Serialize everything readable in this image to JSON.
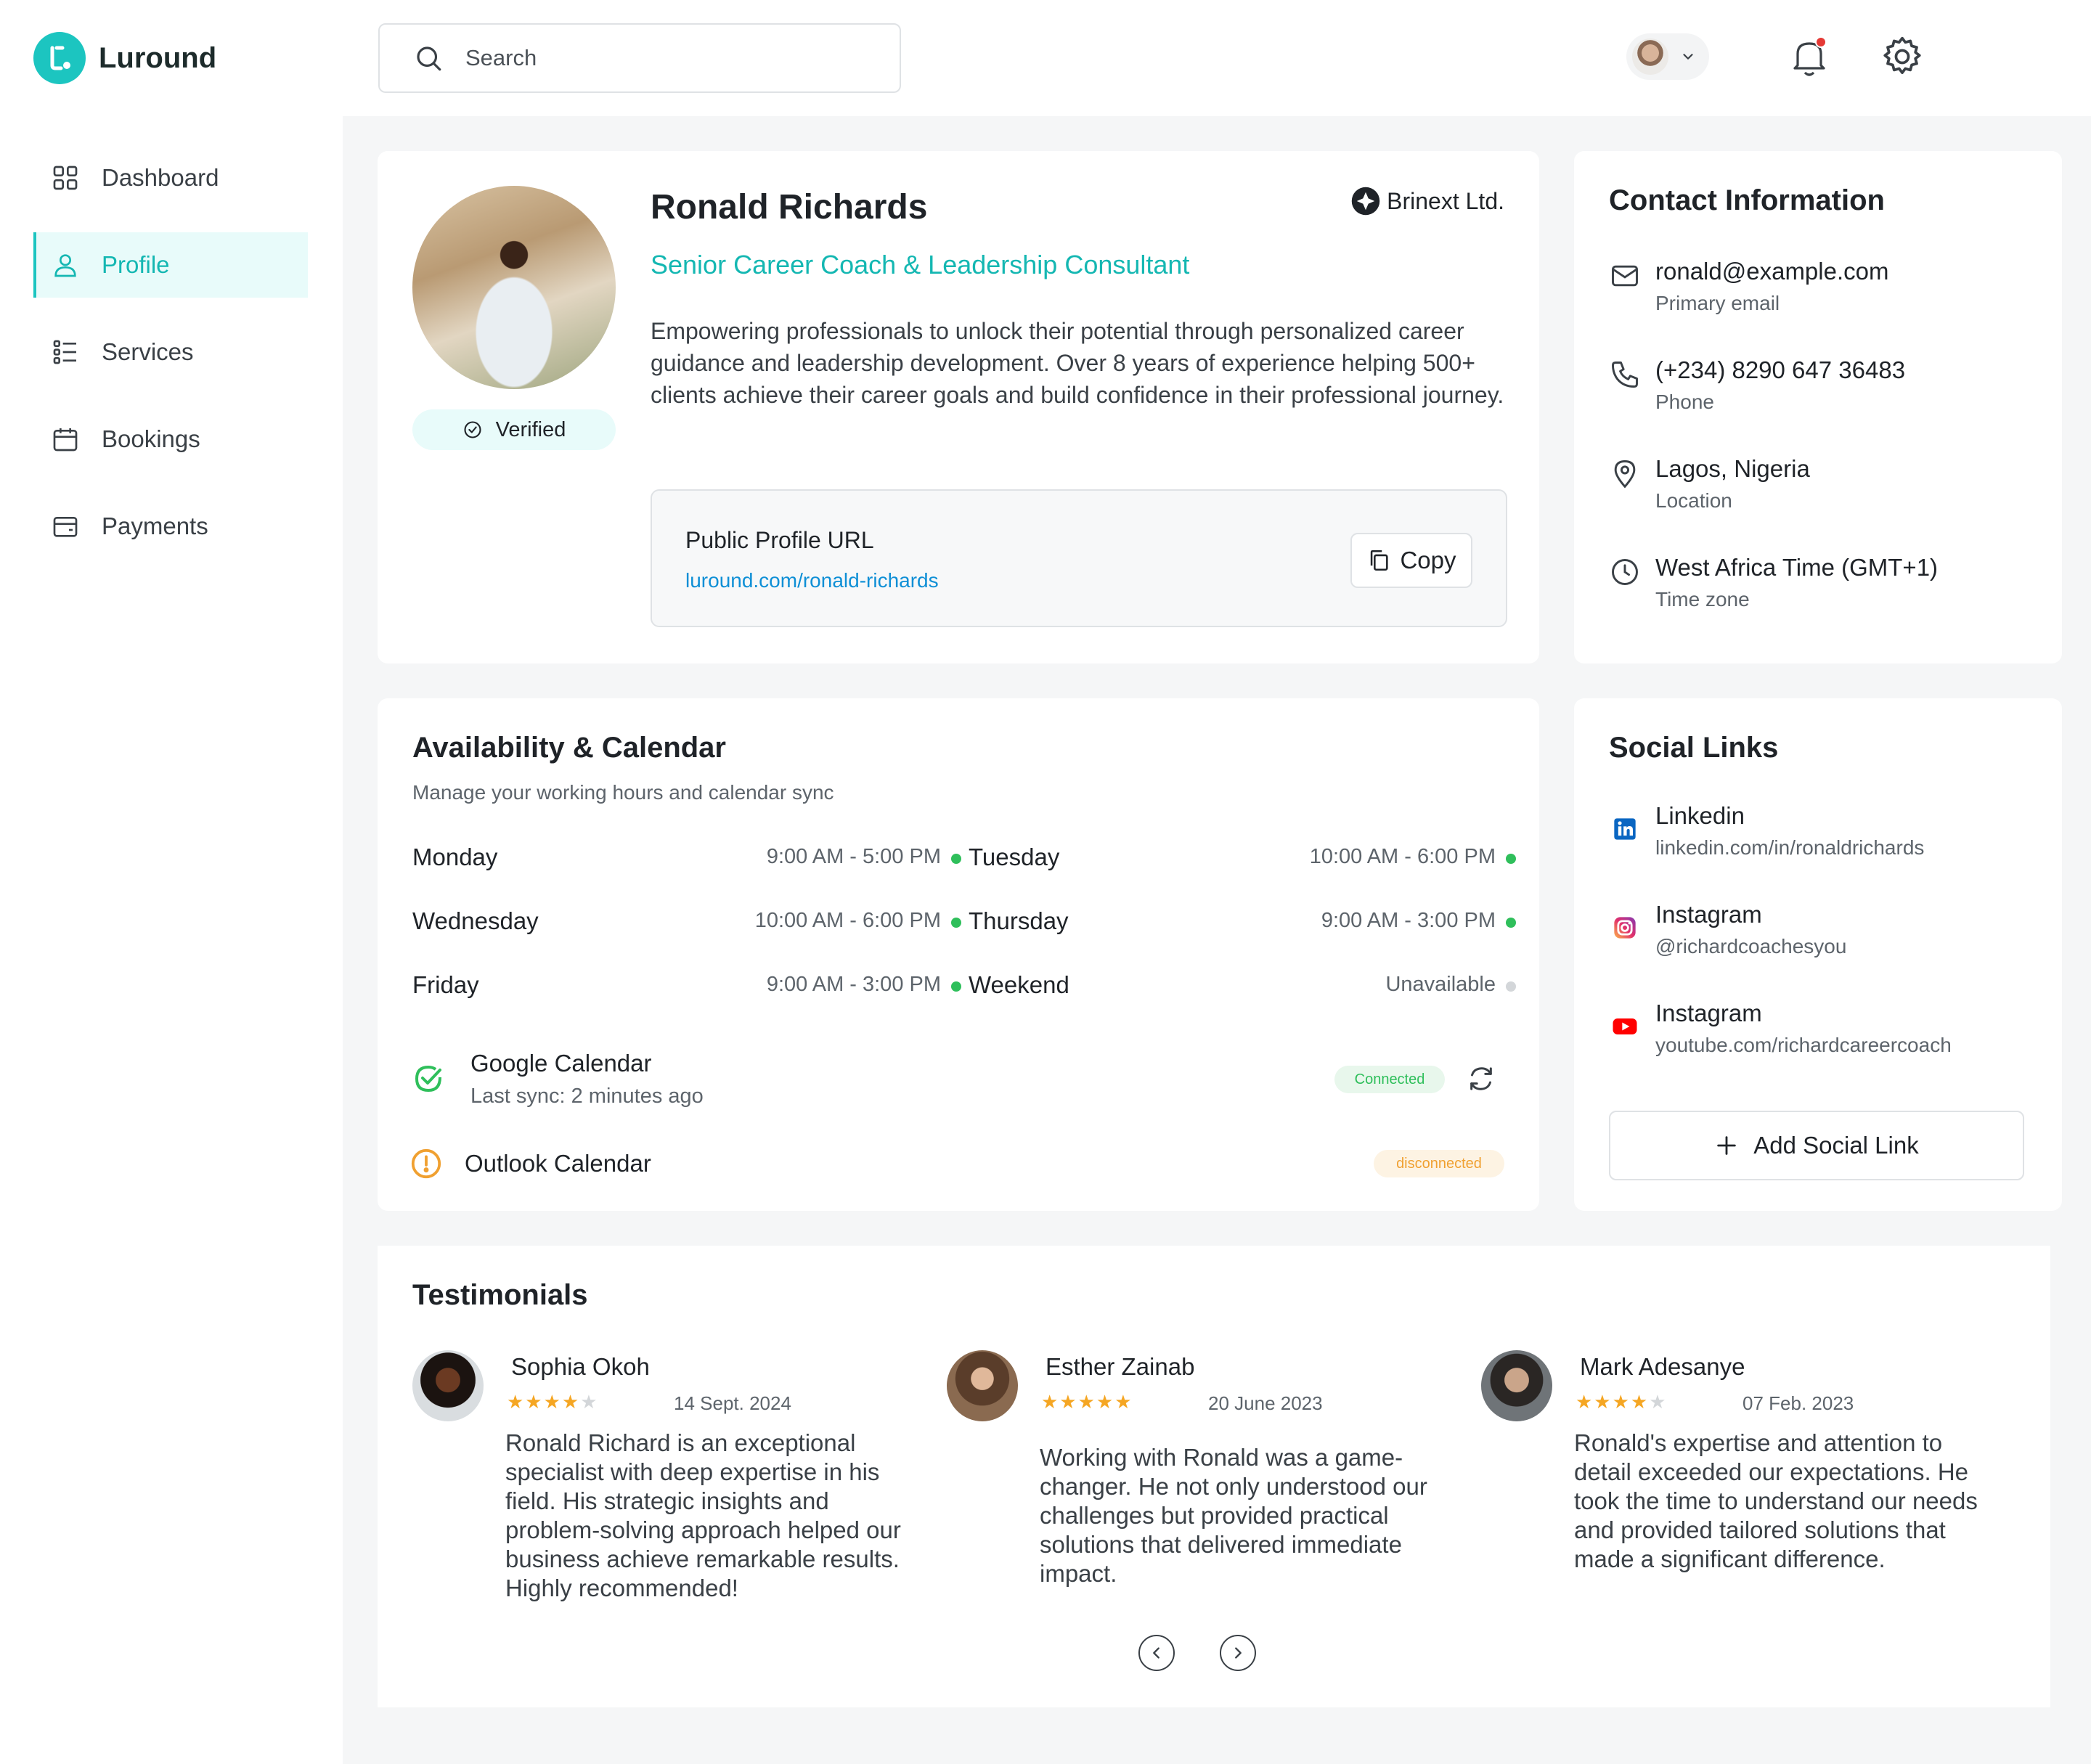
{
  "brand": {
    "name": "Luround",
    "accent": "#1cc5c0"
  },
  "sidebar": {
    "items": [
      {
        "label": "Dashboard",
        "icon": "grid-icon",
        "active": false
      },
      {
        "label": "Profile",
        "icon": "user-icon",
        "active": true
      },
      {
        "label": "Services",
        "icon": "list-icon",
        "active": false
      },
      {
        "label": "Bookings",
        "icon": "calendar-icon",
        "active": false
      },
      {
        "label": "Payments",
        "icon": "wallet-icon",
        "active": false
      }
    ]
  },
  "search": {
    "placeholder": "Search"
  },
  "profile": {
    "name": "Ronald Richards",
    "company": "Brinext Ltd.",
    "title": "Senior Career Coach & Leadership Consultant",
    "bio": "Empowering professionals to unlock their potential through personalized career guidance and leadership development. Over 8 years of experience helping 500+ clients achieve their career goals and build confidence in their professional journey.",
    "verified_label": "Verified",
    "url_label": "Public Profile URL",
    "url": "luround.com/ronald-richards",
    "copy_label": "Copy"
  },
  "contact": {
    "title": "Contact Information",
    "rows": [
      {
        "icon": "mail-icon",
        "value": "ronald@example.com",
        "label": "Primary email"
      },
      {
        "icon": "phone-icon",
        "value": "(+234) 8290 647 36483",
        "label": "Phone"
      },
      {
        "icon": "location-pin-icon",
        "value": "Lagos, Nigeria",
        "label": "Location"
      },
      {
        "icon": "clock-icon",
        "value": "West Africa Time (GMT+1)",
        "label": "Time zone"
      }
    ]
  },
  "availability": {
    "title": "Availability & Calendar",
    "subtitle": "Manage your working hours and calendar sync",
    "days": [
      {
        "day": "Monday",
        "hours": "9:00 AM - 5:00 PM",
        "available": true
      },
      {
        "day": "Tuesday",
        "hours": "10:00 AM - 6:00 PM",
        "available": true
      },
      {
        "day": "Wednesday",
        "hours": "10:00 AM - 6:00 PM",
        "available": true
      },
      {
        "day": "Thursday",
        "hours": "9:00 AM - 3:00 PM",
        "available": true
      },
      {
        "day": "Friday",
        "hours": "9:00 AM - 3:00 PM",
        "available": true
      },
      {
        "day": "Weekend",
        "hours": "Unavailable",
        "available": false
      }
    ],
    "calendars": [
      {
        "name": "Google Calendar",
        "sub": "Last sync: 2 minutes ago",
        "status": "Connected"
      },
      {
        "name": "Outlook Calendar",
        "sub": "",
        "status": "disconnected"
      }
    ],
    "colors": {
      "available": "#2fbf5b",
      "unavailable": "#d3d6d9",
      "warning": "#f0a030"
    }
  },
  "social": {
    "title": "Social Links",
    "links": [
      {
        "icon": "linkedin-icon",
        "name": "Linkedin",
        "handle": "linkedin.com/in/ronaldrichards"
      },
      {
        "icon": "instagram-icon",
        "name": "Instagram",
        "handle": "@richardcoachesyou"
      },
      {
        "icon": "youtube-icon",
        "name": "Instagram",
        "handle": "youtube.com/richardcareercoach"
      }
    ],
    "add_label": "Add Social Link"
  },
  "testimonials": {
    "title": "Testimonials",
    "items": [
      {
        "name": "Sophia Okoh",
        "rating": 4,
        "date": "14 Sept. 2024",
        "text": "Ronald Richard is an exceptional specialist with deep expertise in his field. His strategic insights and problem-solving approach helped our business achieve remarkable results. Highly recommended!"
      },
      {
        "name": "Esther Zainab",
        "rating": 5,
        "date": "20 June 2023",
        "text": "Working with Ronald was a game-changer. He not only understood our challenges but provided practical solutions that delivered immediate impact."
      },
      {
        "name": "Mark Adesanye",
        "rating": 4,
        "date": "07 Feb. 2023",
        "text": "Ronald's expertise and attention to detail exceeded our expectations. He took the time to understand our needs and provided tailored solutions that made a significant difference."
      }
    ]
  }
}
